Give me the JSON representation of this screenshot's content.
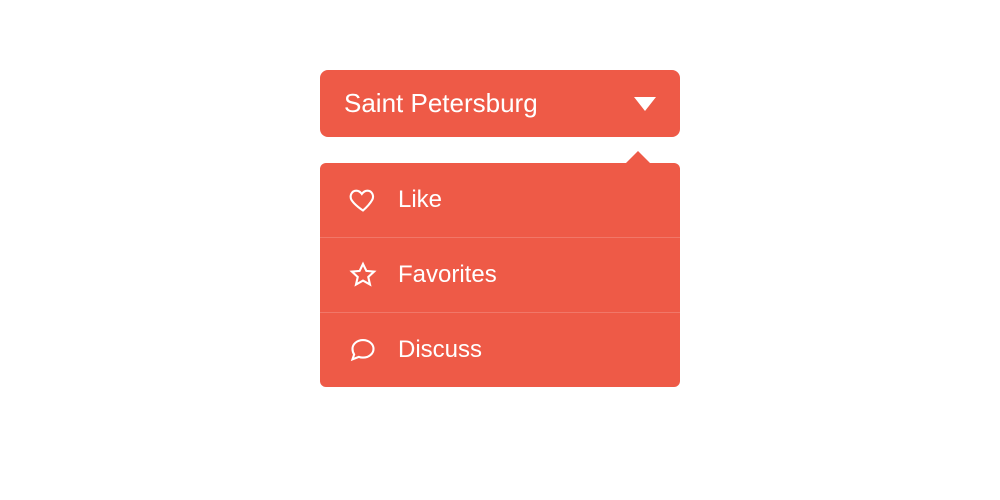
{
  "select": {
    "selected_label": "Saint Petersburg"
  },
  "dropdown": {
    "items": [
      {
        "label": "Like"
      },
      {
        "label": "Favorites"
      },
      {
        "label": "Discuss"
      }
    ]
  }
}
